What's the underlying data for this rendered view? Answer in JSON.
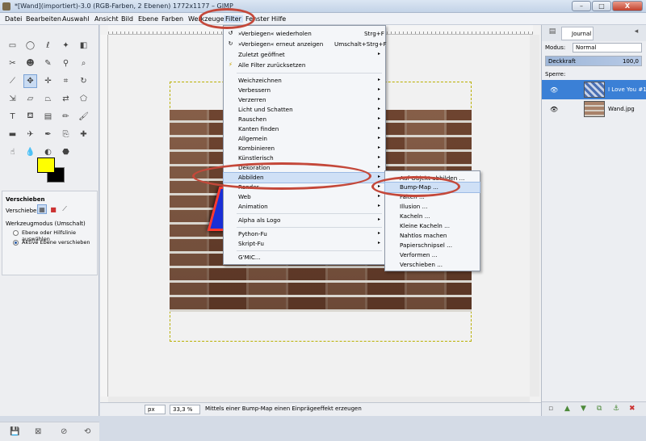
{
  "window": {
    "title": "*[Wand](importiert)-3.0 (RGB-Farben, 2 Ebenen) 1772x1177 – GIMP",
    "minimize": "–",
    "maximize": "□",
    "close": "X"
  },
  "menubar": [
    "Datei",
    "Bearbeiten",
    "Auswahl",
    "Ansicht",
    "Bild",
    "Ebene",
    "Farben",
    "Werkzeuge",
    "Filter",
    "Fenster",
    "Hilfe"
  ],
  "tool_options": {
    "title": "Verschieben",
    "move_label": "Verschieben:",
    "mode_label": "Werkzeugmodus (Umschalt)",
    "option1": "Ebene oder Hilfslinie auswählen",
    "option2": "Aktive Ebene verschieben"
  },
  "filter_menu": {
    "repeat": {
      "label": "»Verbiegen« wiederholen",
      "shortcut": "Strg+F"
    },
    "reshow": {
      "label": "»Verbiegen« erneut anzeigen",
      "shortcut": "Umschalt+Strg+F"
    },
    "recent": "Zuletzt geöffnet",
    "reset": "Alle Filter zurücksetzen",
    "group1": [
      "Weichzeichnen",
      "Verbessern",
      "Verzerren",
      "Licht und Schatten",
      "Rauschen",
      "Kanten finden",
      "Allgemein",
      "Kombinieren",
      "Künstlerisch",
      "Dekoration",
      "Abbilden",
      "Render",
      "Web",
      "Animation"
    ],
    "alpha": "Alpha als Logo",
    "group2": [
      "Python-Fu",
      "Skript-Fu"
    ],
    "gmic": "G'MIC..."
  },
  "abbilden_submenu": [
    "Auf Objekt abbilden ...",
    "Bump-Map ...",
    "Falten ...",
    "Illusion ...",
    "Kacheln ...",
    "Kleine Kacheln ...",
    "Nahtlos machen",
    "Papierschnipsel ...",
    "Verformen ...",
    "Verschieben ..."
  ],
  "status": {
    "unit": "px",
    "zoom": "33,3 %",
    "message": "Mittels einer Bump-Map einen Einprägeeffekt erzeugen"
  },
  "dock": {
    "tab_journal": "Journal",
    "mode_label": "Modus:",
    "mode_value": "Normal",
    "opacity_label": "Deckkraft",
    "opacity_value": "100,0",
    "lock_label": "Sperre:",
    "layers": [
      {
        "name": "I Love You #1",
        "selected": true
      },
      {
        "name": "Wand.jpg",
        "selected": false
      }
    ]
  },
  "colors": {
    "accent": "#3b80d6",
    "highlight_oval": "#c4483a",
    "foreground": "#ffff00",
    "background": "#000000"
  }
}
